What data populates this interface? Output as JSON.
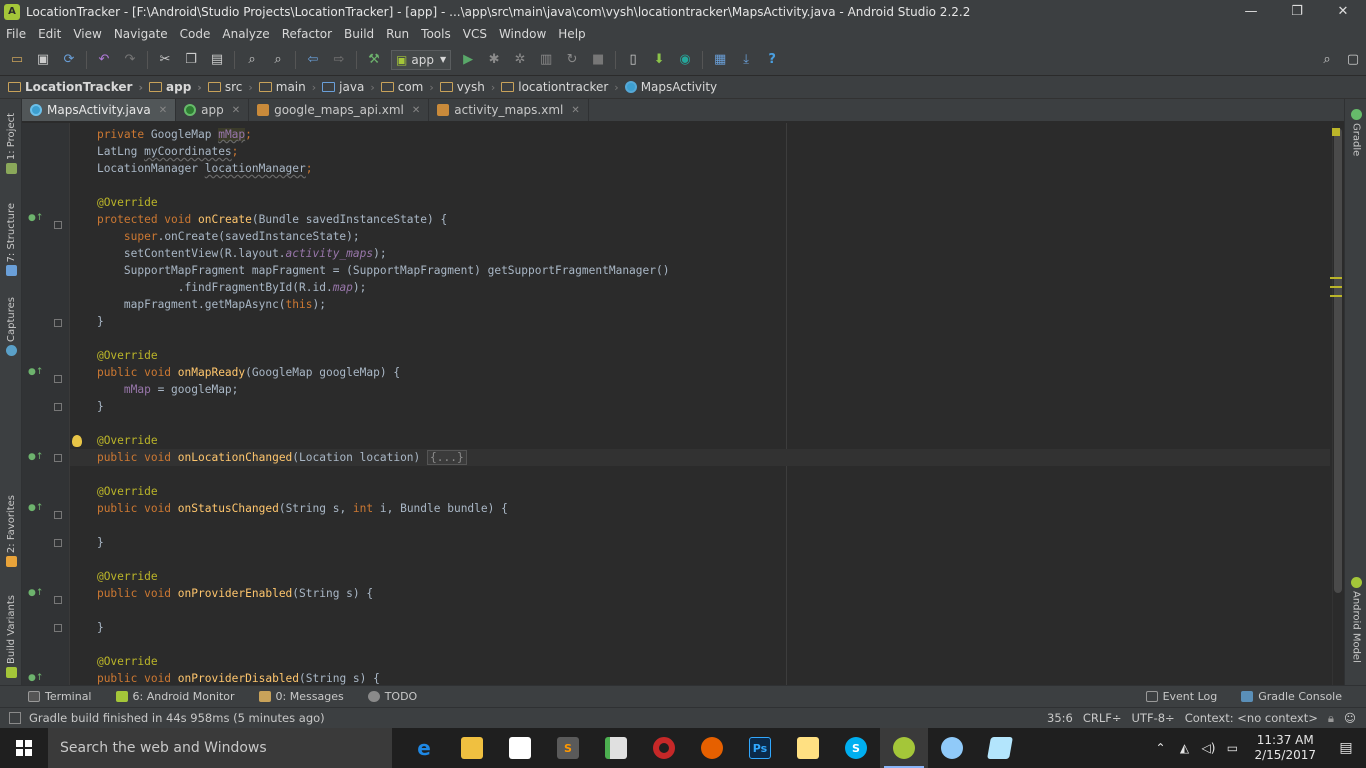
{
  "window": {
    "title": "LocationTracker - [F:\\Android\\Studio Projects\\LocationTracker] - [app] - ...\\app\\src\\main\\java\\com\\vysh\\locationtracker\\MapsActivity.java - Android Studio 2.2.2",
    "minimize": "—",
    "maximize": "❐",
    "close": "✕"
  },
  "menu": [
    "File",
    "Edit",
    "View",
    "Navigate",
    "Code",
    "Analyze",
    "Refactor",
    "Build",
    "Run",
    "Tools",
    "VCS",
    "Window",
    "Help"
  ],
  "toolbar": {
    "run_config": "app",
    "help": "?"
  },
  "breadcrumb": [
    "LocationTracker",
    "app",
    "src",
    "main",
    "java",
    "com",
    "vysh",
    "locationtracker",
    "MapsActivity"
  ],
  "tabs": [
    {
      "label": "MapsActivity.java",
      "active": true
    },
    {
      "label": "app",
      "active": false
    },
    {
      "label": "google_maps_api.xml",
      "active": false
    },
    {
      "label": "activity_maps.xml",
      "active": false
    }
  ],
  "left_tools": [
    "1: Project",
    "7: Structure",
    "Captures",
    "2: Favorites",
    "Build Variants"
  ],
  "right_tools": [
    "Gradle",
    "Android Model"
  ],
  "code": {
    "l1": {
      "a": "private ",
      "b": "GoogleMap ",
      "c": "mMap",
      "d": ";"
    },
    "l2": {
      "a": "LatLng ",
      "b": "myCoordinates",
      "c": ";"
    },
    "l3": {
      "a": "LocationManager ",
      "b": "locationManager",
      "c": ";"
    },
    "override": "@Override",
    "l5": {
      "a": "protected void ",
      "b": "onCreate",
      "c": "(Bundle savedInstanceState) {"
    },
    "l6": {
      "a": "super",
      "b": ".onCreate(savedInstanceState);"
    },
    "l7": {
      "a": "setContentView(R.layout.",
      "b": "activity_maps",
      "c": ");"
    },
    "l8": "SupportMapFragment mapFragment = (SupportMapFragment) getSupportFragmentManager()",
    "l9": {
      "a": ".findFragmentById(R.id.",
      "b": "map",
      "c": ");"
    },
    "l10": {
      "a": "mapFragment.getMapAsync(",
      "b": "this",
      "c": ");"
    },
    "close_brace": "}",
    "l13": {
      "a": "public void ",
      "b": "onMapReady",
      "c": "(GoogleMap googleMap) {"
    },
    "l14": {
      "a": "mMap",
      "b": " = googleMap;"
    },
    "l17": {
      "a": "public void ",
      "b": "onLocationChanged",
      "c": "(Location location) ",
      "d": "{...}"
    },
    "l19": {
      "a": "public void ",
      "b": "onStatusChanged",
      "c": "(String s, ",
      "d": "int ",
      "e": "i, Bundle bundle) {"
    },
    "l22": {
      "a": "public void ",
      "b": "onProviderEnabled",
      "c": "(String s) {"
    },
    "l25": {
      "a": "public void ",
      "b": "onProviderDisabled",
      "c": "(String s) {"
    }
  },
  "bottom_tools": {
    "left": [
      "Terminal",
      "6: Android Monitor",
      "0: Messages",
      "TODO"
    ],
    "right": [
      "Event Log",
      "Gradle Console"
    ]
  },
  "status": {
    "message": "Gradle build finished in 44s 958ms (5 minutes ago)",
    "position": "35:6",
    "line_sep": "CRLF÷",
    "encoding": "UTF-8÷",
    "context": "Context: <no context>"
  },
  "taskbar": {
    "search_placeholder": "Search the web and Windows",
    "apps": [
      {
        "name": "edge",
        "glyph": "e",
        "color": "#1e88e5"
      },
      {
        "name": "explorer",
        "glyph": "",
        "color": "#f0c040"
      },
      {
        "name": "store",
        "glyph": "",
        "color": "#ffffff"
      },
      {
        "name": "sublime",
        "glyph": "S",
        "color": "#5a5a5a"
      },
      {
        "name": "notepad",
        "glyph": "",
        "color": "#4caf50"
      },
      {
        "name": "media",
        "glyph": "",
        "color": "#c62828"
      },
      {
        "name": "firefox",
        "glyph": "",
        "color": "#e66000"
      },
      {
        "name": "photoshop",
        "glyph": "Ps",
        "color": "#0b2a4a"
      },
      {
        "name": "photos",
        "glyph": "",
        "color": "#ffe082"
      },
      {
        "name": "skype",
        "glyph": "S",
        "color": "#00aff0"
      },
      {
        "name": "android-studio",
        "glyph": "",
        "color": "#a4c639"
      },
      {
        "name": "paint",
        "glyph": "",
        "color": "#90caf9"
      },
      {
        "name": "other",
        "glyph": "",
        "color": "#b3e5fc"
      }
    ],
    "time": "11:37 AM",
    "date": "2/15/2017"
  }
}
